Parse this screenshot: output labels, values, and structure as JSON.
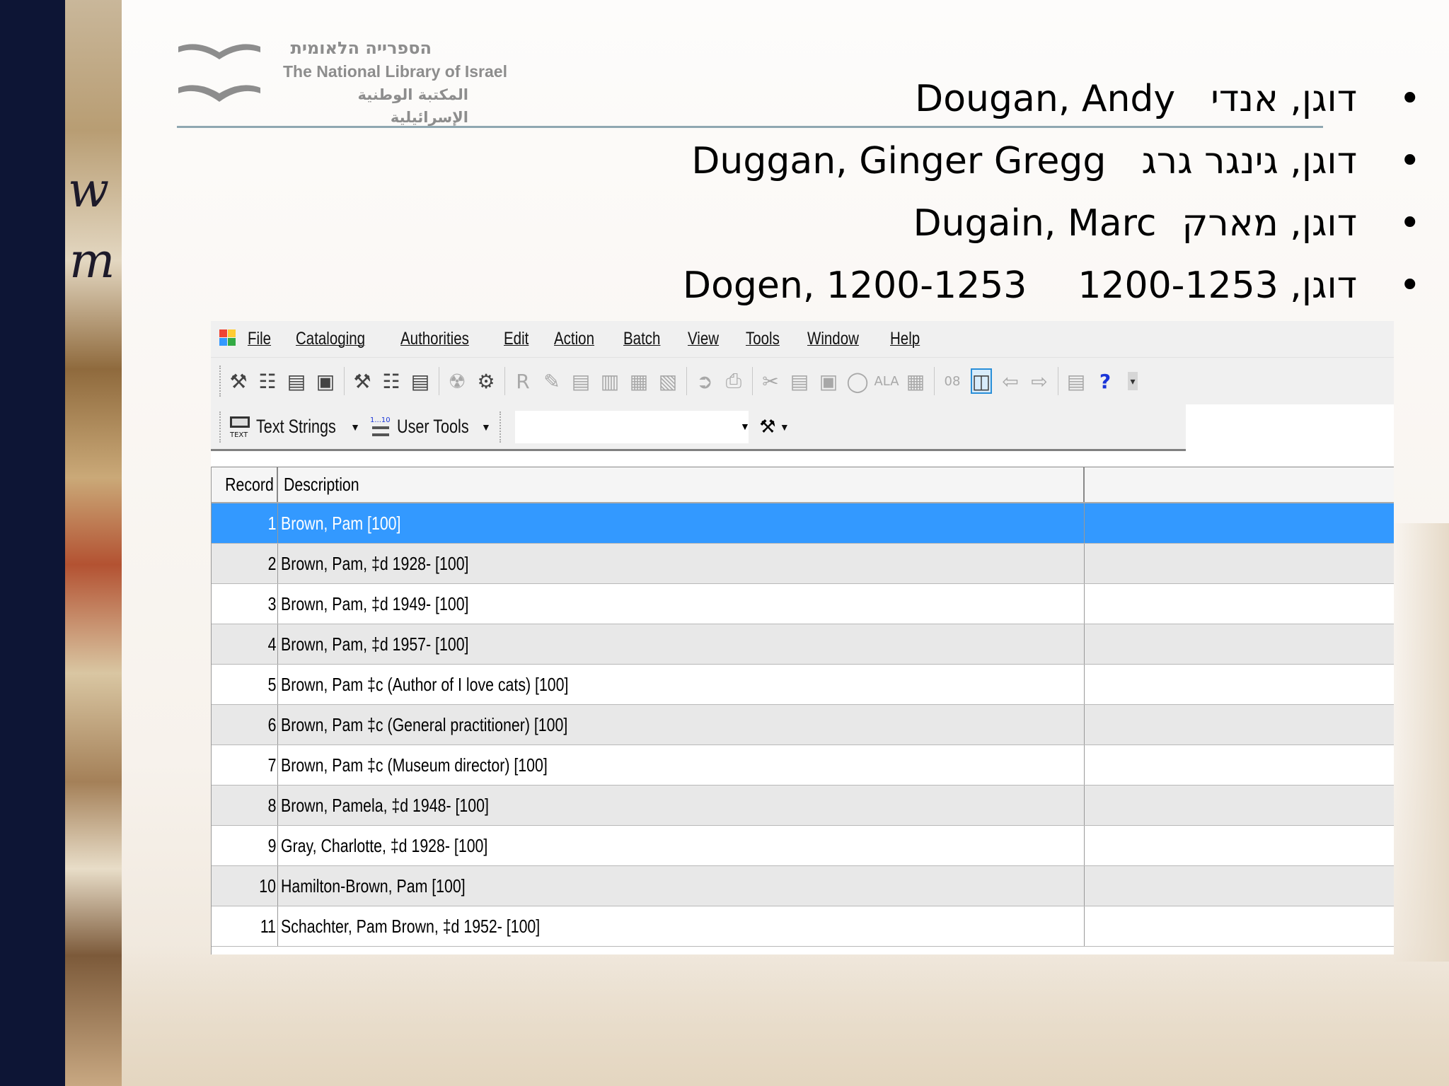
{
  "logo": {
    "hebrew": "הספרייה הלאומית",
    "english": "The National Library of Israel",
    "arabic": "المكتبة الوطنية الإسرائيلية"
  },
  "bullets": [
    {
      "hebrew": "דוגן, אנדי",
      "english": "Dougan, Andy"
    },
    {
      "hebrew": "דוגן, גינגר גרג",
      "english": "Duggan, Ginger Gregg"
    },
    {
      "hebrew": "דוגן, מארק",
      "english": "Dugain, Marc"
    },
    {
      "hebrew": "דוגן, 1200-1253",
      "english": "Dogen, 1200-1253"
    }
  ],
  "menu": [
    "File",
    "Cataloging",
    "Authorities",
    "Edit",
    "Action",
    "Batch",
    "View",
    "Tools",
    "Window",
    "Help"
  ],
  "toolbar2": {
    "text_strings": "Text Strings",
    "user_tools": "User Tools",
    "text_icon_label": "TEXT",
    "user_tools_icon_label": "1...10"
  },
  "grid": {
    "headers": {
      "record": "Record",
      "description": "Description"
    },
    "rows": [
      {
        "record": "1",
        "description": "Brown, Pam [100]"
      },
      {
        "record": "2",
        "description": "Brown, Pam, ‡d 1928- [100]"
      },
      {
        "record": "3",
        "description": "Brown, Pam, ‡d 1949- [100]"
      },
      {
        "record": "4",
        "description": "Brown, Pam, ‡d 1957- [100]"
      },
      {
        "record": "5",
        "description": "Brown, Pam ‡c (Author of I love cats) [100]"
      },
      {
        "record": "6",
        "description": "Brown, Pam ‡c (General practitioner) [100]"
      },
      {
        "record": "7",
        "description": "Brown, Pam ‡c (Museum director) [100]"
      },
      {
        "record": "8",
        "description": "Brown, Pamela, ‡d 1948- [100]"
      },
      {
        "record": "9",
        "description": "Gray, Charlotte, ‡d 1928- [100]"
      },
      {
        "record": "10",
        "description": "Hamilton-Brown, Pam [100]"
      },
      {
        "record": "11",
        "description": "Schachter, Pam Brown, ‡d 1952- [100]"
      }
    ],
    "selected_record": "1"
  },
  "colors": {
    "left_bar": "#0d1535",
    "selection": "#3399ff",
    "logo_gray": "#8d8d8d",
    "rule": "#8fa7b1"
  }
}
